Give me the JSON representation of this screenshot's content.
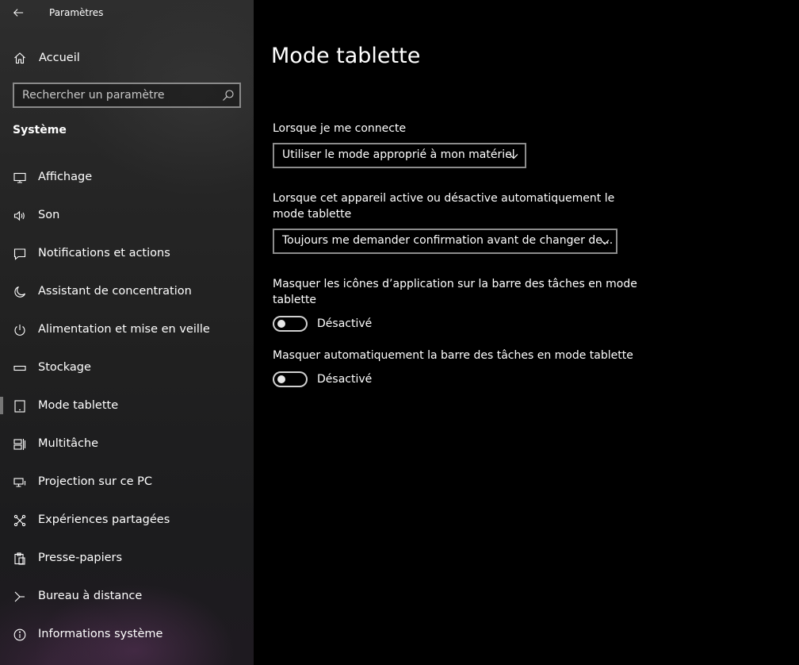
{
  "app": {
    "title": "Paramètres"
  },
  "sidebar": {
    "home_label": "Accueil",
    "search_placeholder": "Rechercher un paramètre",
    "section_heading": "Système",
    "items": [
      {
        "label": "Affichage",
        "icon": "monitor-icon"
      },
      {
        "label": "Son",
        "icon": "speaker-icon"
      },
      {
        "label": "Notifications et actions",
        "icon": "message-icon"
      },
      {
        "label": "Assistant de concentration",
        "icon": "moon-icon"
      },
      {
        "label": "Alimentation et mise en veille",
        "icon": "power-icon"
      },
      {
        "label": "Stockage",
        "icon": "storage-icon"
      },
      {
        "label": "Mode tablette",
        "icon": "tablet-icon",
        "selected": true
      },
      {
        "label": "Multitâche",
        "icon": "multitask-icon"
      },
      {
        "label": "Projection sur ce PC",
        "icon": "projection-icon"
      },
      {
        "label": "Expériences partagées",
        "icon": "shared-icon"
      },
      {
        "label": "Presse-papiers",
        "icon": "clipboard-icon"
      },
      {
        "label": "Bureau à distance",
        "icon": "remote-desktop-icon"
      },
      {
        "label": "Informations système",
        "icon": "info-icon"
      }
    ]
  },
  "main": {
    "page_title": "Mode tablette",
    "signin": {
      "label": "Lorsque je me connecte",
      "value": "Utiliser le mode approprié à mon matériel"
    },
    "auto_switch": {
      "label": "Lorsque cet appareil active ou désactive automatiquement le mode tablette",
      "value": "Toujours me demander confirmation avant de changer de..."
    },
    "hide_icons": {
      "label": "Masquer les icônes d’application sur la barre des tâches en mode tablette",
      "state": "Désactivé",
      "on": false
    },
    "auto_hide_taskbar": {
      "label": "Masquer automatiquement la barre des tâches en mode tablette",
      "state": "Désactivé",
      "on": false
    }
  },
  "colors": {
    "background": "#000000",
    "sidebar": "#262626",
    "border": "#8c8c8c",
    "text": "#ffffff"
  }
}
